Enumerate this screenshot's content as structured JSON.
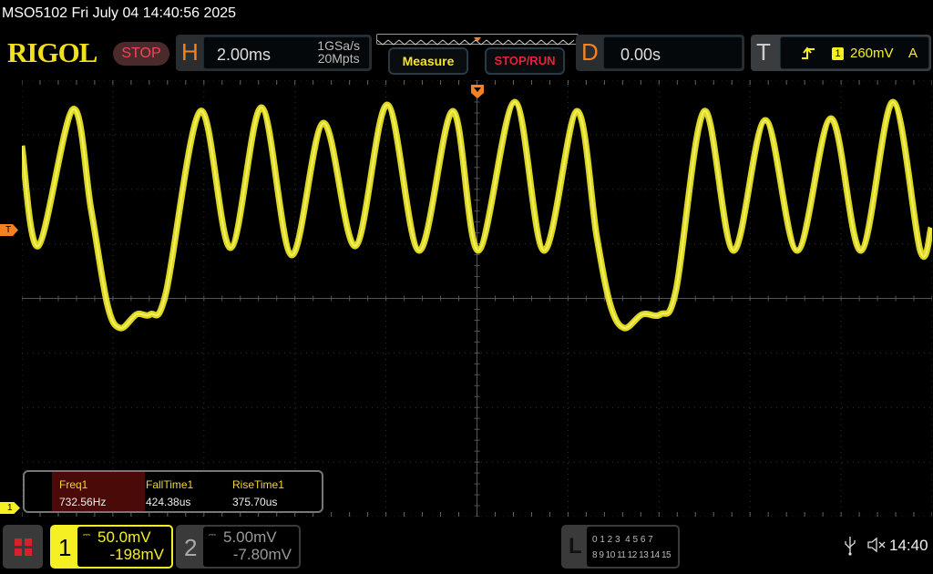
{
  "title": "MSO5102  Fri July 04 14:40:56 2025",
  "logo": "RIGOL",
  "run_state": "STOP",
  "horizontal": {
    "label": "H",
    "timebase": "2.00ms",
    "sample_rate": "1GSa/s",
    "memory_depth": "20Mpts"
  },
  "buttons": {
    "measure": "Measure",
    "stop_run": "STOP/RUN"
  },
  "delay": {
    "label": "D",
    "value": "0.00s"
  },
  "trigger": {
    "label": "T",
    "slope_icon": "rising-edge-icon",
    "source": "1",
    "level": "260mV",
    "mode": "A"
  },
  "markers": {
    "trigger_level": "T",
    "channel1": "1"
  },
  "measurements": [
    {
      "label": "Freq1",
      "value": "732.56Hz"
    },
    {
      "label": "FallTime1",
      "value": "424.38us"
    },
    {
      "label": "RiseTime1",
      "value": "375.70us"
    }
  ],
  "channels": [
    {
      "number": "1",
      "scale": "50.0mV",
      "offset": "-198mV",
      "color": "#f5f023",
      "active": true
    },
    {
      "number": "2",
      "scale": "5.00mV",
      "offset": "-7.80mV",
      "color": "#888888",
      "active": false
    }
  ],
  "logic": {
    "label": "L",
    "row1": "0 1 2 3  4 5 6 7",
    "row2": "8 9 10 11 12 13 14 15"
  },
  "status": {
    "usb_icon": "usb-icon",
    "sound_icon": "speaker-muted-icon",
    "time": "14:40"
  },
  "colors": {
    "ch1": "#f5f023",
    "accent": "#f5821f",
    "stop": "#f0465a"
  }
}
